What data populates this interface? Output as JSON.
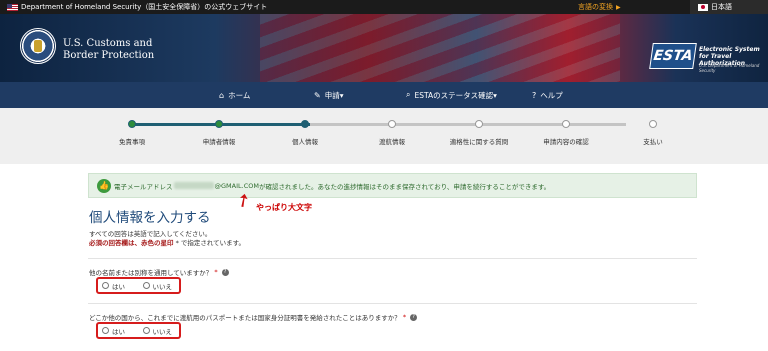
{
  "topbar": {
    "official": "Department of Homeland Security（国土安全保障省）の公式ウェブサイト",
    "lang_change": "言語の変換",
    "lang_current": "日本語"
  },
  "header": {
    "agency_line1": "U.S. Customs and",
    "agency_line2": "Border Protection",
    "esta_logo": "ESTA",
    "esta_tagline": "Electronic System for Travel Authorization",
    "esta_dhs": "U.S. Department of Homeland Security"
  },
  "nav": {
    "home": "ホーム",
    "apply": "申請▾",
    "status": "ESTAのステータス確認▾",
    "help": "ヘルプ"
  },
  "progress": {
    "steps": [
      "免責事項",
      "申請者情報",
      "個人情報",
      "渡航情報",
      "適格性に関する質問",
      "申請内容の確認",
      "支払い"
    ],
    "current_index": 2
  },
  "alert": {
    "prefix": "電子メールアドレス",
    "domain": "@GMAIL.COM",
    "message": "が確認されました。あなたの進捗情報はそのまま保存されており、申請を続行することができます。"
  },
  "annotation": {
    "note": "やっぱり大文字"
  },
  "main": {
    "title": "個人情報を入力する",
    "intro1": "すべての回答は英語で記入してください。",
    "intro2_req": "必須の回答欄は、赤色の星印",
    "intro2_rest": " * で指定されています。",
    "q1": "他の名前または別称を通用していますか？",
    "q2": "どこか他の国から、これまでに渡航用のパスポートまたは国家身分証明書を発給されたことはありますか？",
    "required_mark": "*",
    "yes": "はい",
    "no": "いいえ"
  },
  "colors": {
    "nav_bg": "#1f3b63",
    "step_done": "#2d8c3c",
    "title": "#1f4a7a",
    "highlight": "#d61c1c"
  }
}
